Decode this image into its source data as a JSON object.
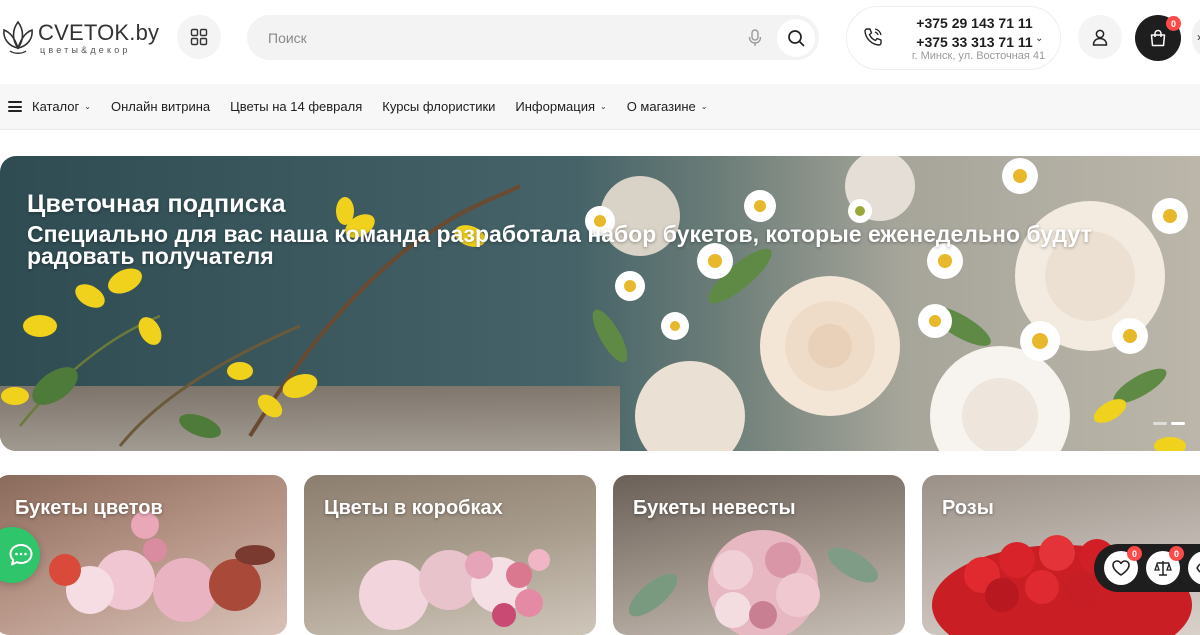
{
  "logo": {
    "name": "CVETOK.by",
    "tagline": "цветы&декор"
  },
  "search": {
    "placeholder": "Поиск"
  },
  "contacts": {
    "phones": [
      "+375 29 143 71 11",
      "+375 33 313 71 11"
    ],
    "address": "г. Минск, ул. Восточная 41"
  },
  "cart": {
    "count": "0"
  },
  "nav": {
    "items": [
      {
        "label": "Каталог",
        "has_dropdown": true
      },
      {
        "label": "Онлайн витрина",
        "has_dropdown": false
      },
      {
        "label": "Цветы на 14 февраля",
        "has_dropdown": false
      },
      {
        "label": "Курсы флористики",
        "has_dropdown": false
      },
      {
        "label": "Информация",
        "has_dropdown": true
      },
      {
        "label": "О магазине",
        "has_dropdown": true
      }
    ]
  },
  "hero": {
    "title": "Цветочная подписка",
    "subtitle_line1": "Специально для вас наша команда разработала набор букетов, которые еженедельно будут",
    "subtitle_line2": "радовать получателя",
    "slides_total": 2,
    "active_slide": 2
  },
  "categories": [
    {
      "label": "Букеты цветов"
    },
    {
      "label": "Цветы в коробках"
    },
    {
      "label": "Букеты невесты"
    },
    {
      "label": "Розы"
    }
  ],
  "floating": {
    "favorites_count": "0",
    "compare_count": "0"
  },
  "icons": {
    "grid": "grid-icon",
    "mic": "microphone-icon",
    "search": "search-icon",
    "phone": "phone-icon",
    "user": "user-icon",
    "cart": "shopping-bag-icon",
    "menu": "menu-icon",
    "chat": "chat-icon",
    "heart": "heart-icon",
    "compare": "scales-icon",
    "eye": "eye-icon"
  },
  "colors": {
    "accent_dark": "#1e1e1e",
    "badge": "#ff4a4a",
    "chat": "#2fc56a"
  }
}
